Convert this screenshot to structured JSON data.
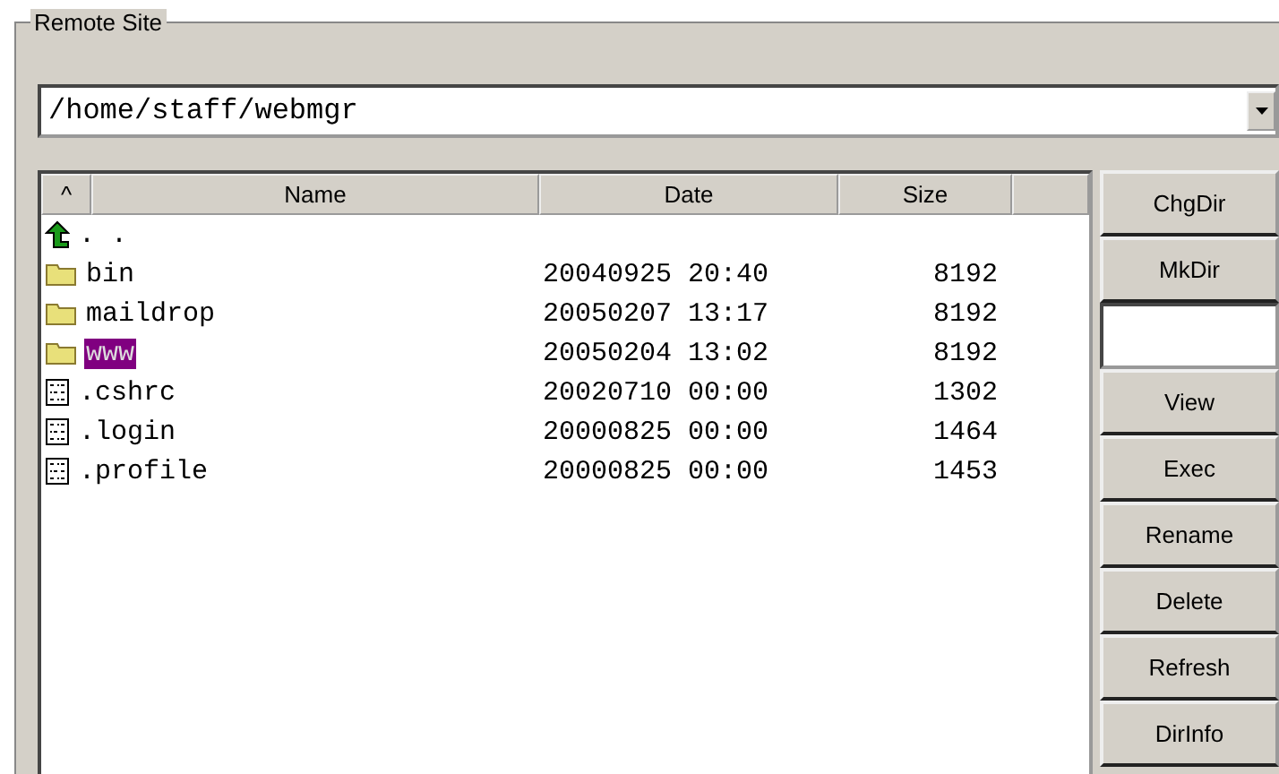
{
  "group": {
    "title": "Remote Site"
  },
  "path": {
    "value": "/home/staff/webmgr"
  },
  "columns": [
    {
      "label": "^"
    },
    {
      "label": "Name"
    },
    {
      "label": "Date"
    },
    {
      "label": "Size"
    }
  ],
  "rows": [
    {
      "kind": "up",
      "name": ". .",
      "date": "",
      "size": "",
      "selected": false
    },
    {
      "kind": "folder",
      "name": "bin",
      "date": "20040925 20:40",
      "size": "8192",
      "selected": false
    },
    {
      "kind": "folder",
      "name": "maildrop",
      "date": "20050207 13:17",
      "size": "8192",
      "selected": false
    },
    {
      "kind": "folder",
      "name": "www",
      "date": "20050204 13:02",
      "size": "8192",
      "selected": true
    },
    {
      "kind": "file",
      "name": ".cshrc",
      "date": "20020710 00:00",
      "size": "1302",
      "selected": false
    },
    {
      "kind": "file",
      "name": ".login",
      "date": "20000825 00:00",
      "size": "1464",
      "selected": false
    },
    {
      "kind": "file",
      "name": ".profile",
      "date": "20000825 00:00",
      "size": "1453",
      "selected": false
    }
  ],
  "buttons": [
    {
      "kind": "button",
      "label": "ChgDir"
    },
    {
      "kind": "button",
      "label": "MkDir"
    },
    {
      "kind": "field"
    },
    {
      "kind": "button",
      "label": "View"
    },
    {
      "kind": "button",
      "label": "Exec"
    },
    {
      "kind": "button",
      "label": "Rename"
    },
    {
      "kind": "button",
      "label": "Delete"
    },
    {
      "kind": "button",
      "label": "Refresh"
    },
    {
      "kind": "button",
      "label": "DirInfo"
    }
  ]
}
